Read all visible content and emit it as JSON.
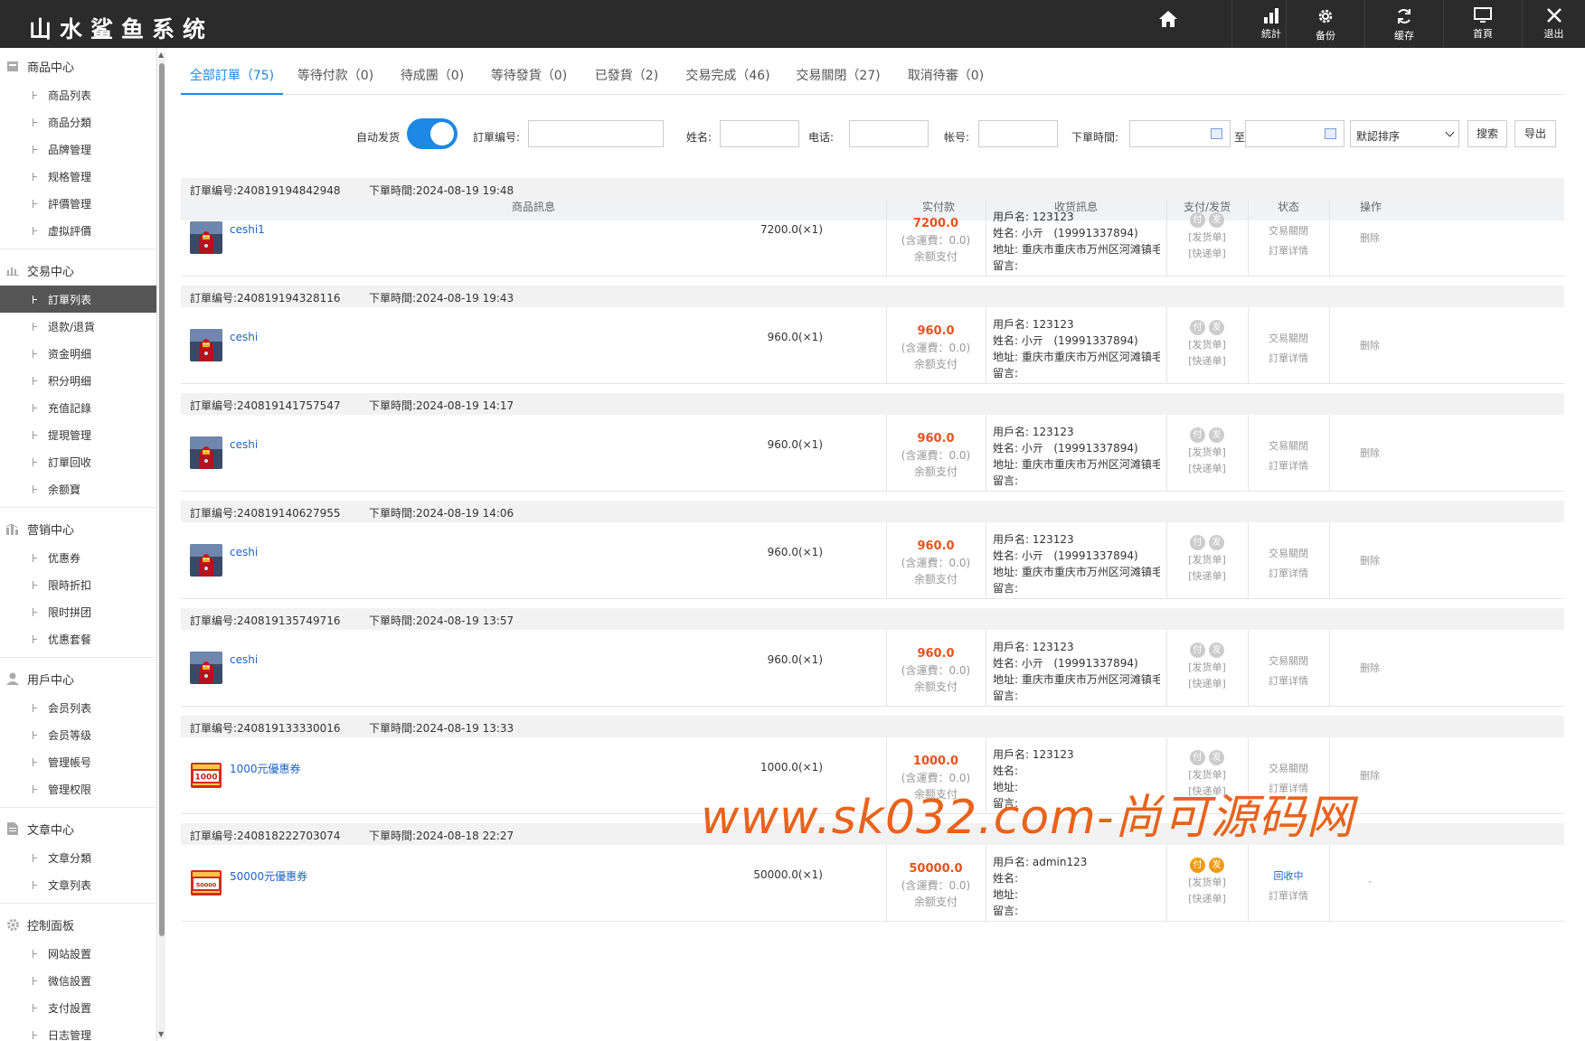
{
  "app": {
    "title": "山水鲨鱼系统"
  },
  "toolbar": {
    "home_icon": "home-icon",
    "items": [
      {
        "label": "統計",
        "icon": "bar-chart-icon"
      },
      {
        "label": "备份",
        "icon": "gear-icon"
      },
      {
        "label": "缓存",
        "icon": "refresh-icon"
      },
      {
        "label": "首頁",
        "icon": "monitor-icon"
      },
      {
        "label": "退出",
        "icon": "close-icon"
      }
    ]
  },
  "sidebar": {
    "groups": [
      {
        "label": "商品中心",
        "icon": "box-icon",
        "items": [
          "商品列表",
          "商品分類",
          "品牌管理",
          "规格管理",
          "評價管理",
          "虚拟評價"
        ]
      },
      {
        "label": "交易中心",
        "icon": "bar-chart-icon",
        "items": [
          "訂單列表",
          "退款/退貨",
          "资金明细",
          "积分明细",
          "充值記錄",
          "提現管理",
          "訂單回收",
          "余额寶"
        ]
      },
      {
        "label": "营销中心",
        "icon": "marketing-icon",
        "items": [
          "优惠券",
          "限時折扣",
          "限时拼团",
          "优惠套餐"
        ]
      },
      {
        "label": "用戶中心",
        "icon": "user-icon",
        "items": [
          "会员列表",
          "会员等级",
          "管理帳号",
          "管理权限"
        ]
      },
      {
        "label": "文章中心",
        "icon": "document-icon",
        "items": [
          "文章分類",
          "文章列表"
        ]
      },
      {
        "label": "控制面板",
        "icon": "gear-icon",
        "items": [
          "网站設置",
          "微信設置",
          "支付設置",
          "日志管理"
        ]
      }
    ],
    "active_item": "訂單列表"
  },
  "tabs": [
    {
      "label": "全部訂單（75)",
      "active": true
    },
    {
      "label": "等待付款（0)"
    },
    {
      "label": "待成團（0)"
    },
    {
      "label": "等待發貨（0)"
    },
    {
      "label": "已發貨（2)"
    },
    {
      "label": "交易完成（46)"
    },
    {
      "label": "交易關閉（27)"
    },
    {
      "label": "取消待審（0)"
    }
  ],
  "filters": {
    "auto_ship_label": "自动发货",
    "auto_ship_on": true,
    "order_no_label": "訂單编号:",
    "name_label": "姓名:",
    "phone_label": "电话:",
    "account_label": "帐号:",
    "time_label": "下單時間:",
    "to_label": "至",
    "sort_value": "默認排序",
    "search_button": "搜索",
    "export_button": "导出"
  },
  "table_headers": {
    "goods": "商品訊息",
    "paid": "实付款",
    "receiver": "收货訊息",
    "pay_ship": "支付/发货",
    "status": "状态",
    "action": "操作"
  },
  "order_labels": {
    "order_no_prefix": "訂單编号:",
    "time_prefix": "下單時間:",
    "freight_note": "(含運費：0.0)",
    "pay_method": "余额支付",
    "user_prefix": "用戶名:",
    "name_prefix": "姓名:",
    "address_prefix": "地址:",
    "message_prefix": "留言:",
    "pay_badge": "付",
    "ship_badge": "发",
    "ship_doc": "[发货单]",
    "express_doc": "[快递单]",
    "order_detail": "訂單详情",
    "delete": "删除"
  },
  "orders": [
    {
      "no": "240819194842948",
      "time": "2024-08-19 19:48",
      "product": "ceshi1",
      "thumb": "iron-man",
      "qty": "7200.0(×1)",
      "amount": "7200.0",
      "username": "123123",
      "name": "小亓",
      "phone": "(19991337894)",
      "address": "重庆市重庆市万州区河滩镇毛...",
      "status": "交易關閉",
      "action": "删除",
      "paid": false
    },
    {
      "no": "240819194328116",
      "time": "2024-08-19 19:43",
      "product": "ceshi",
      "thumb": "iron-man",
      "qty": "960.0(×1)",
      "amount": "960.0",
      "username": "123123",
      "name": "小亓",
      "phone": "(19991337894)",
      "address": "重庆市重庆市万州区河滩镇毛...",
      "status": "交易關閉",
      "action": "删除",
      "paid": false
    },
    {
      "no": "240819141757547",
      "time": "2024-08-19 14:17",
      "product": "ceshi",
      "thumb": "iron-man",
      "qty": "960.0(×1)",
      "amount": "960.0",
      "username": "123123",
      "name": "小亓",
      "phone": "(19991337894)",
      "address": "重庆市重庆市万州区河滩镇毛...",
      "status": "交易關閉",
      "action": "删除",
      "paid": false
    },
    {
      "no": "240819140627955",
      "time": "2024-08-19 14:06",
      "product": "ceshi",
      "thumb": "iron-man",
      "qty": "960.0(×1)",
      "amount": "960.0",
      "username": "123123",
      "name": "小亓",
      "phone": "(19991337894)",
      "address": "重庆市重庆市万州区河滩镇毛...",
      "status": "交易關閉",
      "action": "删除",
      "paid": false
    },
    {
      "no": "240819135749716",
      "time": "2024-08-19 13:57",
      "product": "ceshi",
      "thumb": "iron-man",
      "qty": "960.0(×1)",
      "amount": "960.0",
      "username": "123123",
      "name": "小亓",
      "phone": "(19991337894)",
      "address": "重庆市重庆市万州区河滩镇毛...",
      "status": "交易關閉",
      "action": "删除",
      "paid": false
    },
    {
      "no": "240819133330016",
      "time": "2024-08-19 13:33",
      "product": "1000元優惠券",
      "thumb": "coupon",
      "thumb_text": "1000",
      "qty": "1000.0(×1)",
      "amount": "1000.0",
      "username": "123123",
      "name": "",
      "phone": "",
      "address": "",
      "status": "交易關閉",
      "action": "删除",
      "paid": false
    },
    {
      "no": "240818222703074",
      "time": "2024-08-18 22:27",
      "product": "50000元優惠券",
      "thumb": "coupon",
      "thumb_text": "50000",
      "qty": "50000.0(×1)",
      "amount": "50000.0",
      "username": "admin123",
      "name": "",
      "phone": "",
      "address": "",
      "status": "回收中",
      "status_blue": true,
      "action": "-",
      "paid": true
    }
  ],
  "watermark": "www.sk032.com-尚可源码网",
  "colors": {
    "accent": "#1e88e5",
    "amount": "#e8521c",
    "link": "#1e63c6",
    "badge_active": "#f29a12",
    "topbar": "#2b2b2b",
    "watermark": "#e8631c"
  }
}
